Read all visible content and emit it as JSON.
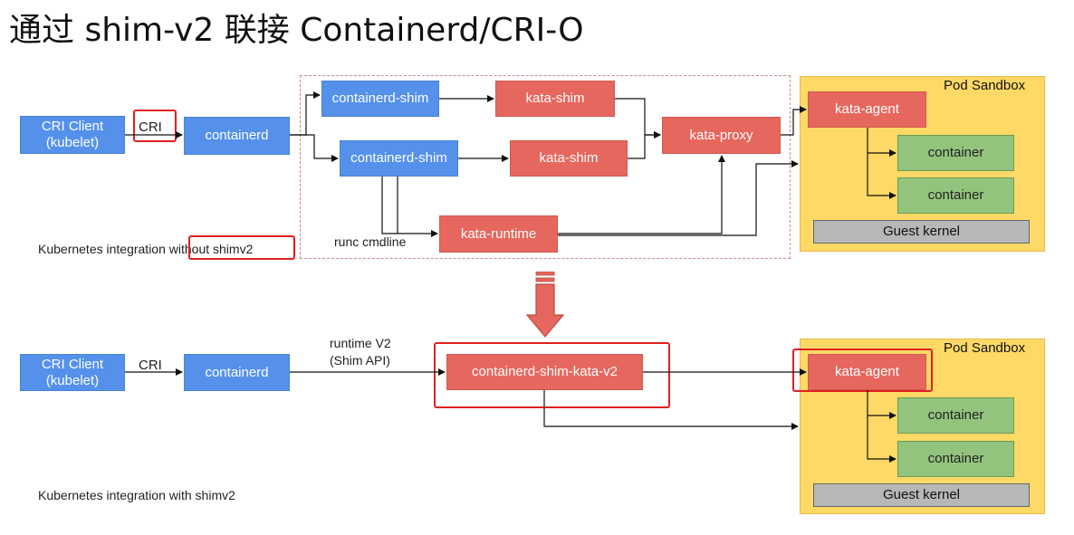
{
  "title": "通过 shim-v2 联接 Containerd/CRI-O",
  "top": {
    "cri_client": "CRI Client\n(kubelet)",
    "cri_label": "CRI",
    "containerd": "containerd",
    "containerd_shim_1": "containerd-shim",
    "containerd_shim_2": "containerd-shim",
    "kata_shim_1": "kata-shim",
    "kata_shim_2": "kata-shim",
    "kata_proxy": "kata-proxy",
    "kata_runtime": "kata-runtime",
    "runc_label": "runc cmdline",
    "caption_prefix": "Kubernetes integration ",
    "caption_highlight": "without shimv2",
    "sandbox": {
      "label": "Pod Sandbox",
      "agent": "kata-agent",
      "container_1": "container",
      "container_2": "container",
      "kernel": "Guest kernel"
    }
  },
  "bottom": {
    "cri_client": "CRI Client\n(kubelet)",
    "cri_label": "CRI",
    "containerd": "containerd",
    "runtime_label_1": "runtime V2",
    "runtime_label_2": "(Shim API)",
    "shim_kata_v2": "containerd-shim-kata-v2",
    "caption": "Kubernetes integration with shimv2",
    "sandbox": {
      "label": "Pod Sandbox",
      "agent": "kata-agent",
      "container_1": "container",
      "container_2": "container",
      "kernel": "Guest kernel"
    }
  },
  "colors": {
    "blue": "#5591ea",
    "red": "#e6675e",
    "green": "#93c47d",
    "sandbox": "#ffd966",
    "kernel": "#b7b7b7",
    "highlight": "#e02020"
  },
  "icons": {
    "transition": "down-arrow-icon"
  }
}
